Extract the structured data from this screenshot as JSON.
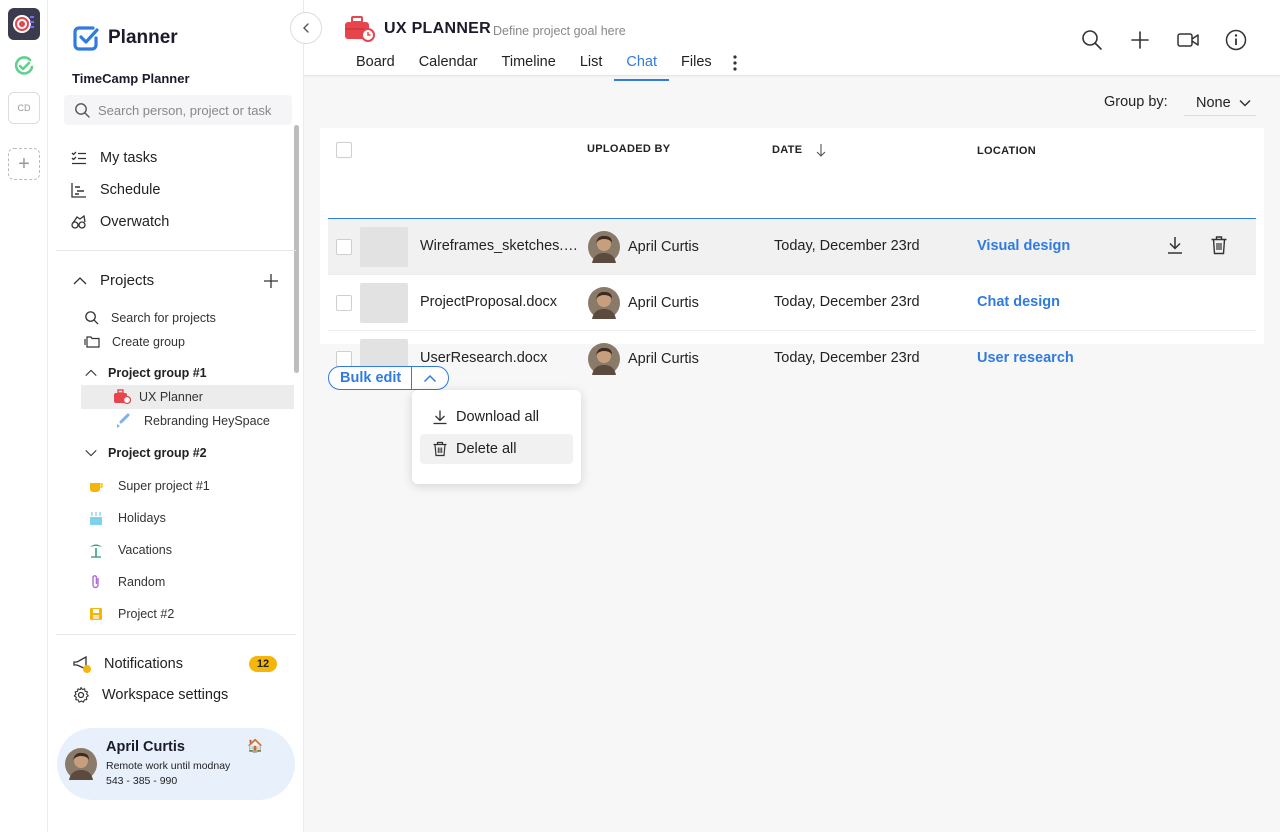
{
  "sidebar": {
    "logo_text": "Planner",
    "workspace_name": "TimeCamp Planner",
    "search_placeholder": "Search person, project or task",
    "nav": [
      {
        "label": "My tasks",
        "icon": "list-check-icon"
      },
      {
        "label": "Schedule",
        "icon": "gantt-icon"
      },
      {
        "label": "Overwatch",
        "icon": "binoculars-icon"
      }
    ],
    "projects_label": "Projects",
    "search_projects": "Search for projects",
    "create_group": "Create group",
    "groups": [
      {
        "name": "Project group #1",
        "projects": [
          {
            "label": "UX Planner",
            "icon": "briefcase-icon",
            "active": true
          },
          {
            "label": "Rebranding HeySpace",
            "icon": "brush-icon",
            "active": false
          }
        ]
      },
      {
        "name": "Project group #2",
        "projects": []
      }
    ],
    "loose_projects": [
      {
        "label": "Super project #1",
        "icon": "coffee-icon"
      },
      {
        "label": "Holidays",
        "icon": "cake-icon"
      },
      {
        "label": "Vacations",
        "icon": "palm-tree-icon"
      },
      {
        "label": "Random",
        "icon": "paperclip-icon"
      },
      {
        "label": "Project #2",
        "icon": "floppy-icon"
      }
    ],
    "notifications_label": "Notifications",
    "notifications_count": "12",
    "settings_label": "Workspace settings",
    "user": {
      "name": "April Curtis",
      "status": "Remote work until modnay",
      "phone": "543 - 385 - 990",
      "status_emoji": "🏠"
    }
  },
  "rail": {
    "cd_label": "CD"
  },
  "header": {
    "project_title": "UX PLANNER",
    "project_goal": "Define project goal here",
    "tabs": [
      "Board",
      "Calendar",
      "Timeline",
      "List",
      "Chat",
      "Files"
    ],
    "active_tab": "Chat"
  },
  "main": {
    "group_by_label": "Group by:",
    "group_by_value": "None",
    "columns": {
      "uploaded_by": "UPLOADED BY",
      "date": "DATE",
      "location": "LOCATION"
    },
    "rows": [
      {
        "file": "Wireframes_sketches.pdf",
        "uploader": "April Curtis",
        "date": "Today, December 23rd",
        "location": "Visual design"
      },
      {
        "file": "ProjectProposal.docx",
        "uploader": "April Curtis",
        "date": "Today, December 23rd",
        "location": "Chat design"
      },
      {
        "file": "UserResearch.docx",
        "uploader": "April Curtis",
        "date": "Today, December 23rd",
        "location": "User research"
      }
    ],
    "bulk_edit_label": "Bulk edit",
    "menu": {
      "download_all": "Download all",
      "delete_all": "Delete all"
    }
  },
  "colors": {
    "accent": "#2f7be0",
    "badge": "#f5b60b",
    "user_card": "#e8f0fb"
  }
}
